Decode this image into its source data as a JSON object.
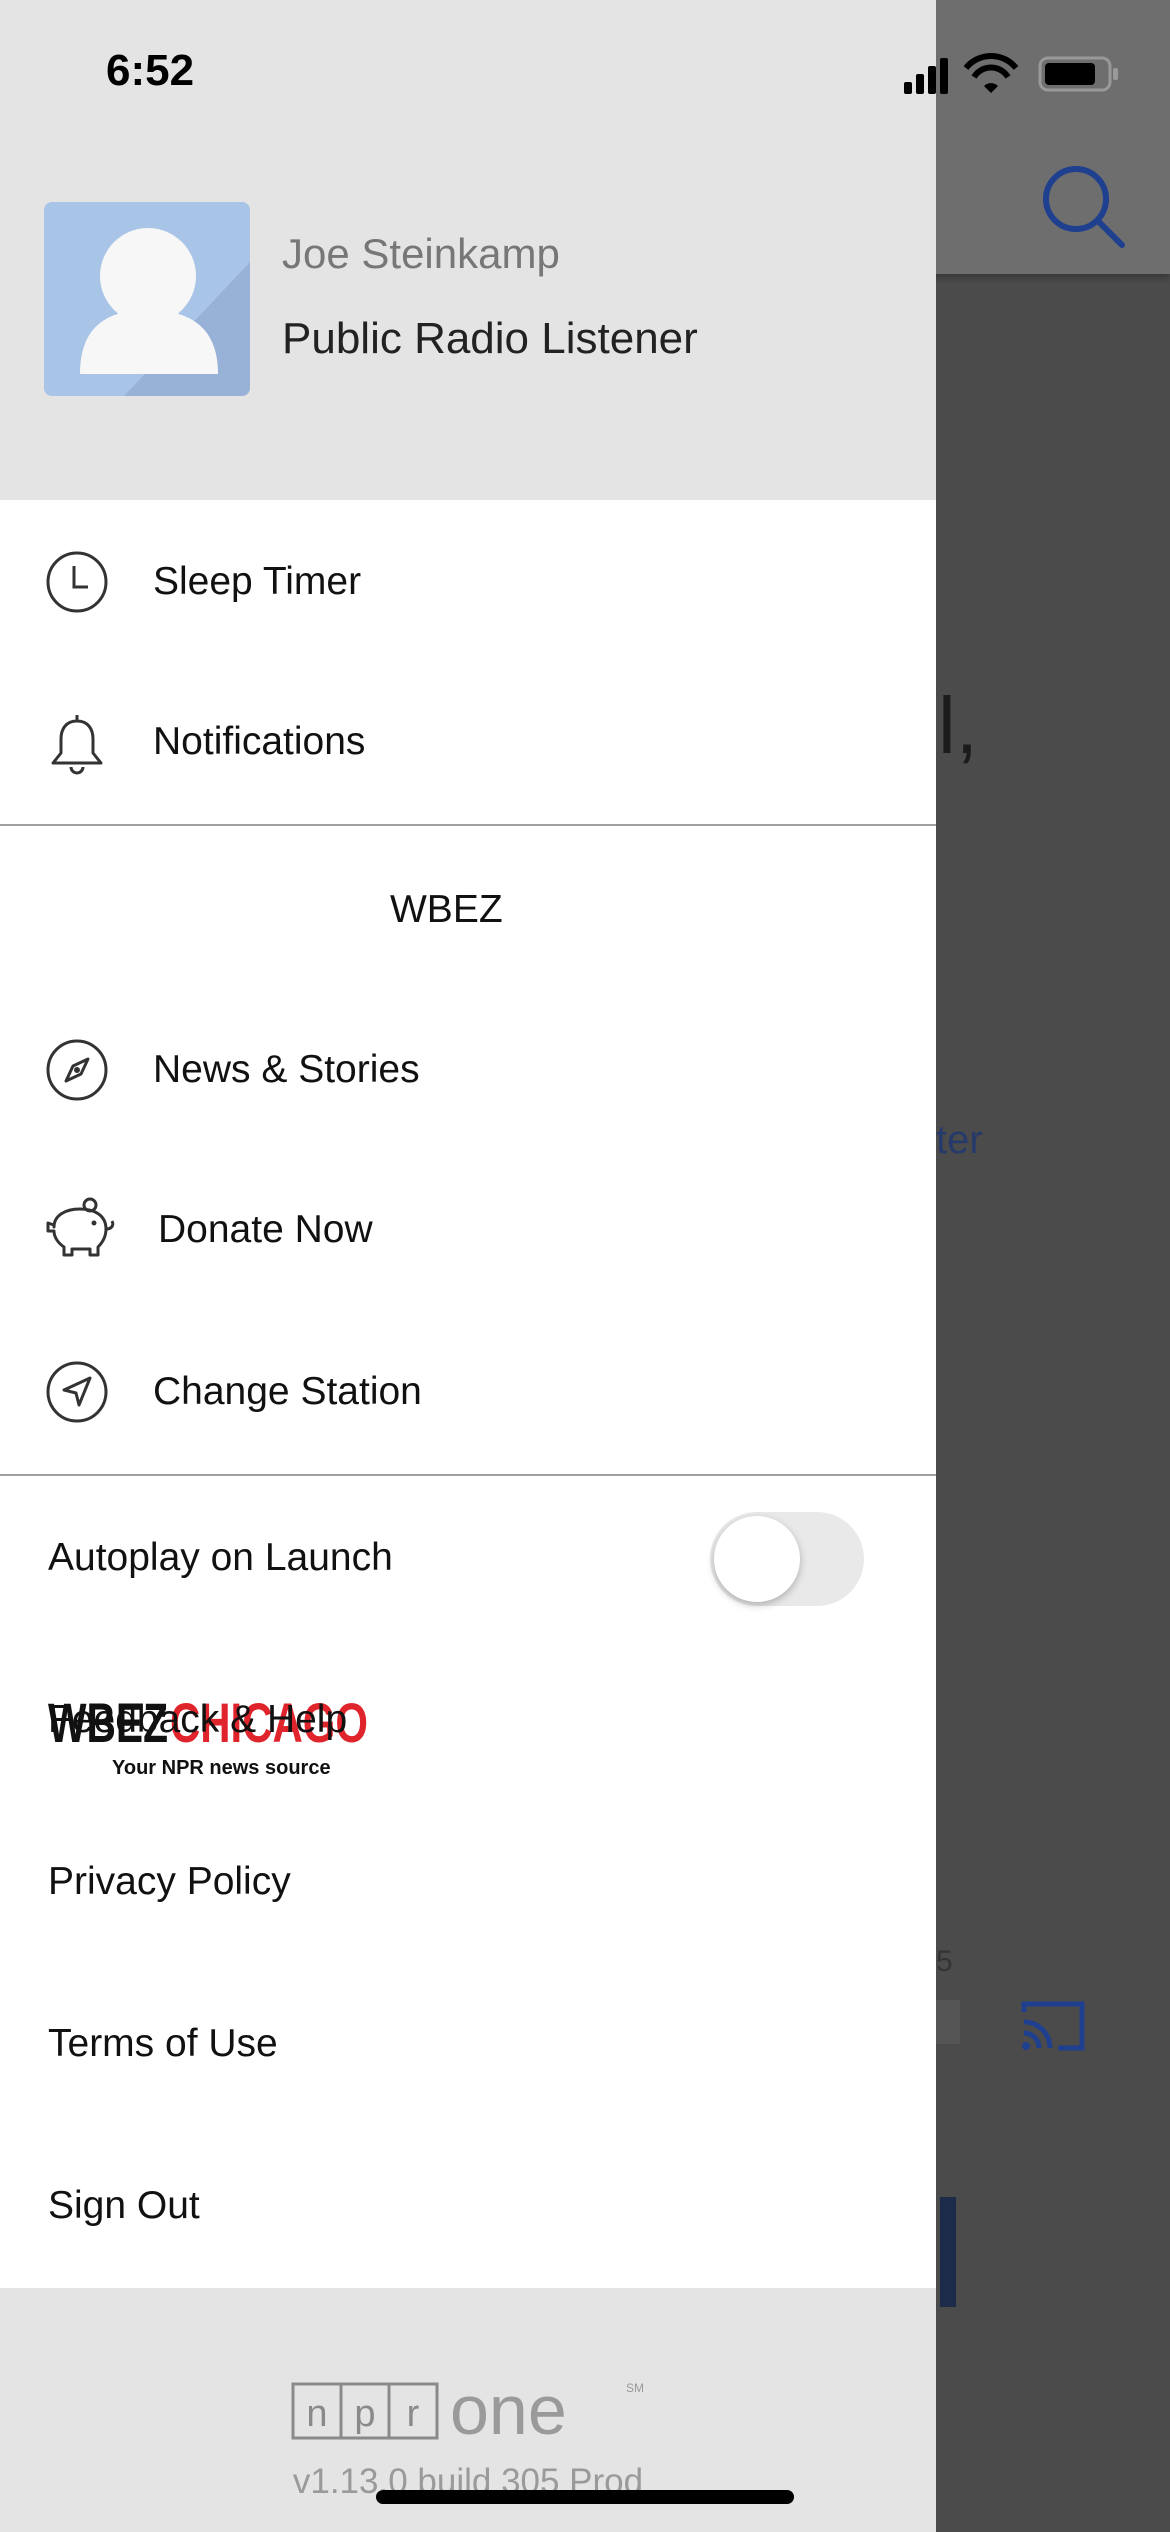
{
  "status_bar": {
    "time": "6:52"
  },
  "profile": {
    "name": "Joe Steinkamp",
    "role": "Public Radio Listener"
  },
  "menu_primary": [
    {
      "label": "Sleep Timer",
      "icon": "clock-icon"
    },
    {
      "label": "Notifications",
      "icon": "bell-icon"
    }
  ],
  "station": {
    "logo_text_main": "WBEZ",
    "logo_text_city": "CHICAGO",
    "logo_tagline": "Your NPR news source",
    "name": "WBEZ"
  },
  "menu_station": [
    {
      "label": "News & Stories",
      "icon": "compass-icon"
    },
    {
      "label": "Donate Now",
      "icon": "piggy-bank-icon"
    },
    {
      "label": "Change Station",
      "icon": "location-arrow-icon"
    }
  ],
  "settings": {
    "autoplay_label": "Autoplay on Launch",
    "autoplay_on": false,
    "feedback_label": "Feedback & Help",
    "privacy_label": "Privacy Policy",
    "terms_label": "Terms of Use",
    "signout_label": "Sign Out"
  },
  "footer": {
    "brand_letters": [
      "n",
      "p",
      "r"
    ],
    "brand_word": "one",
    "brand_mark": "SM",
    "version": "v1.13.0 build 305 Prod"
  },
  "background": {
    "fragment_comma": "l,",
    "fragment_link": "ter",
    "fragment_num": "5"
  },
  "colors": {
    "drawer_header": "#e4e4e4",
    "overlay": "#4b4b4b",
    "accent_blue": "#1f3f8f",
    "wbez_red": "#e0242b"
  }
}
